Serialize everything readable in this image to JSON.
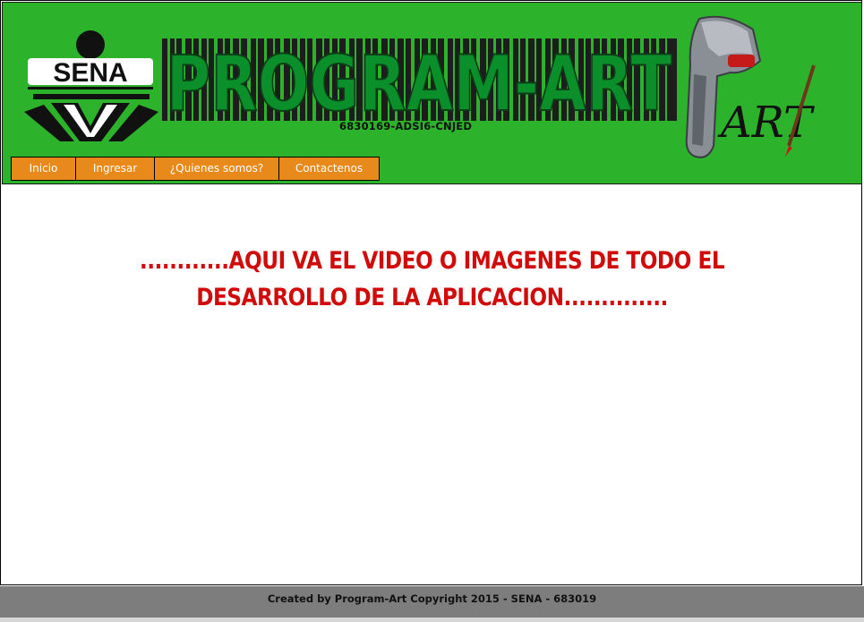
{
  "header": {
    "logo_text": "SENA",
    "banner_title": "PROGRAM-ART",
    "banner_subtitle": "6830169-ADSI6-CNJED",
    "art_logo_text": "ART"
  },
  "nav": {
    "items": [
      {
        "label": "Inicio"
      },
      {
        "label": "Ingresar"
      },
      {
        "label": "¿Quienes somos?"
      },
      {
        "label": "Contactenos"
      }
    ]
  },
  "main": {
    "message": "............AQUI VA EL VIDEO O IMAGENES DE TODO EL DESARROLLO DE LA APLICACION.............."
  },
  "footer": {
    "text": "Created by Program-Art  Copyright 2015 - SENA - 683019"
  },
  "colors": {
    "header_bg": "#2db32b",
    "nav_bg": "#e8891b",
    "message": "#d10a0a",
    "footer_bg": "#7d7d7d"
  }
}
